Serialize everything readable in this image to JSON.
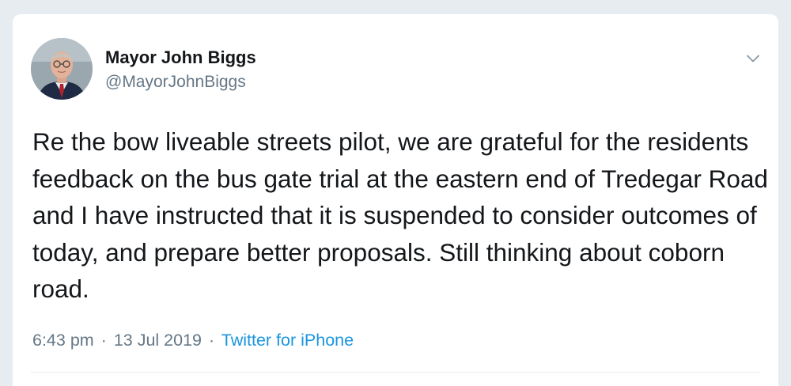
{
  "tweet": {
    "display_name": "Mayor John Biggs",
    "handle": "@MayorJohnBiggs",
    "text": "Re the bow liveable streets pilot, we are grateful for the residents feedback on the bus gate trial at the eastern end of Tredegar Road and I have instructed that it is suspended to consider outcomes of today, and prepare better proposals. Still thinking about coborn road.",
    "time": "6:43 pm",
    "separator": "·",
    "date": "13 Jul 2019",
    "source": "Twitter for iPhone"
  },
  "icons": {
    "menu": "chevron-down-icon",
    "avatar": "profile-photo"
  },
  "colors": {
    "page_background": "#e6ecf0",
    "card_background": "#ffffff",
    "primary_text": "#14171a",
    "secondary_text": "#657786",
    "link": "#1b95e0"
  }
}
